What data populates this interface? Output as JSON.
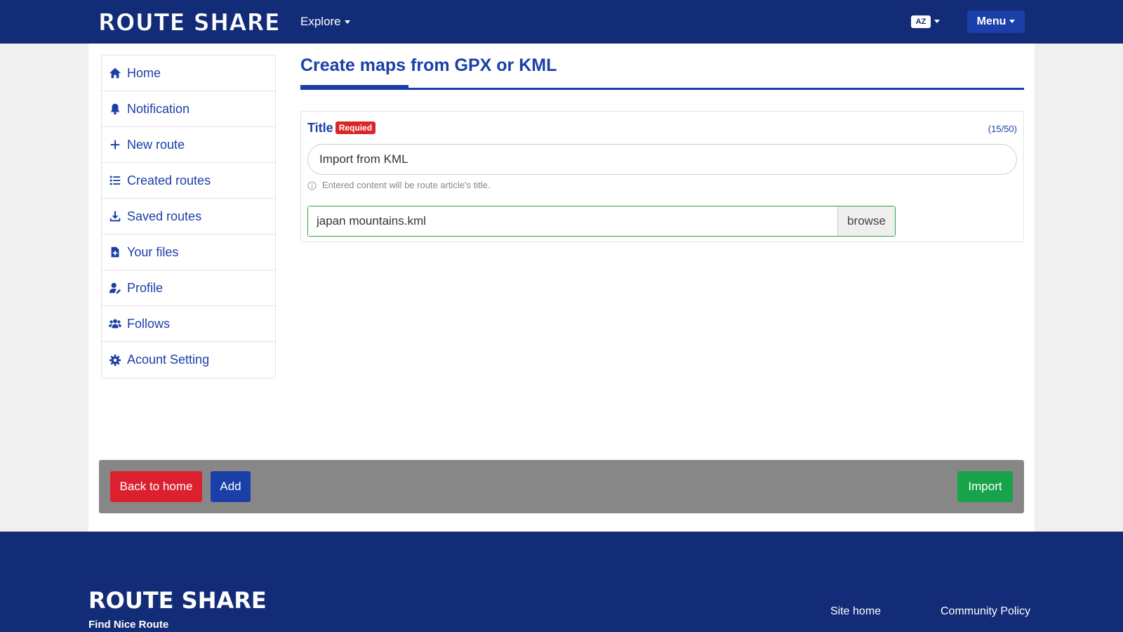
{
  "header": {
    "logo": "ROUTE SHARE",
    "explore_label": "Explore",
    "lang_icon": "AZ",
    "menu_label": "Menu"
  },
  "sidebar": {
    "items": [
      {
        "label": "Home",
        "icon": "home-icon"
      },
      {
        "label": "Notification",
        "icon": "bell-icon"
      },
      {
        "label": "New route",
        "icon": "plus-icon"
      },
      {
        "label": "Created routes",
        "icon": "list-icon"
      },
      {
        "label": "Saved routes",
        "icon": "download-icon"
      },
      {
        "label": "Your files",
        "icon": "file-icon"
      },
      {
        "label": "Profile",
        "icon": "user-edit-icon"
      },
      {
        "label": "Follows",
        "icon": "users-icon"
      },
      {
        "label": "Acount Setting",
        "icon": "gear-icon"
      }
    ]
  },
  "main": {
    "page_title": "Create maps from GPX or KML",
    "form": {
      "title_label": "Title",
      "required_badge": "Requied",
      "counter": "(15/50)",
      "title_value": "Import from KML",
      "help_text": "Entered content will be route article's title.",
      "file_value": "japan mountains.kml",
      "browse_label": "browse"
    }
  },
  "actions": {
    "back_label": "Back to home",
    "add_label": "Add",
    "import_label": "Import"
  },
  "footer": {
    "logo": "ROUTE SHARE",
    "tagline": "Find Nice Route",
    "links": [
      "Site home",
      "Community Policy"
    ]
  },
  "colors": {
    "navy": "#132c77",
    "primary": "#1a3fa8",
    "danger": "#dc2030",
    "success": "#16a34a",
    "action_bar": "#878787"
  }
}
